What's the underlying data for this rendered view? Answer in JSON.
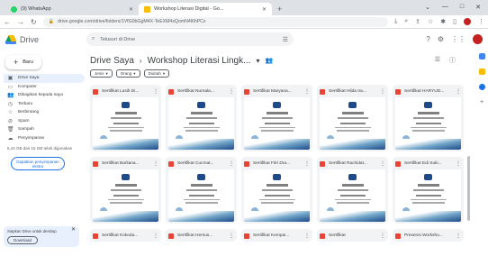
{
  "browser": {
    "tabs": [
      {
        "title": "(9) WhatsApp",
        "favicon_color": "#25d366"
      },
      {
        "title": "Workshop Literasi Digital - Go...",
        "favicon_color": "#fbbc04"
      }
    ],
    "url": "drive.google.com/drive/folders/1VfG0bGgM4X-TeEXM4xQomN4l6hPCx",
    "window_controls": [
      "⌄",
      "—",
      "□",
      "✕"
    ]
  },
  "drive": {
    "app_name": "Drive",
    "search_placeholder": "Telusuri di Drive",
    "new_button": "Baru",
    "sidebar": [
      {
        "icon": "drive-icon",
        "glyph": "▣",
        "label": "Drive Saya"
      },
      {
        "icon": "computer-icon",
        "glyph": "▭",
        "label": "Komputer"
      },
      {
        "icon": "shared-icon",
        "glyph": "👥",
        "label": "Dibagikan kepada saya"
      },
      {
        "icon": "clock-icon",
        "glyph": "◷",
        "label": "Terbaru"
      },
      {
        "icon": "star-icon",
        "glyph": "☆",
        "label": "Berbintang"
      },
      {
        "icon": "spam-icon",
        "glyph": "⊘",
        "label": "Spam"
      },
      {
        "icon": "trash-icon",
        "glyph": "🗑",
        "label": "Sampah"
      },
      {
        "icon": "cloud-icon",
        "glyph": "☁",
        "label": "Penyimpanan"
      }
    ],
    "storage_text": "5,44 GB dari 15 GB telah digunakan",
    "get_storage_button": "Dapatkan penyimpanan ekstra",
    "toast": {
      "text": "Siapkan Drive untuk desktop",
      "button": "Download"
    },
    "breadcrumb": {
      "root": "Drive Saya",
      "separator": "›",
      "folder": "Workshop Literasi Lingk...",
      "dropdown": "▾"
    },
    "filters": [
      {
        "label": "Jenis"
      },
      {
        "label": "Orang"
      },
      {
        "label": "Diubah"
      }
    ],
    "files": [
      {
        "name": "Sertifikat Lusih Di..."
      },
      {
        "name": "Sertifikat Nurnala..."
      },
      {
        "name": "Sertifikat Maryana..."
      },
      {
        "name": "Sertifikat Hilda Ira..."
      },
      {
        "name": "Sertifikat HARYUD..."
      },
      {
        "name": "Sertifikat Barliana..."
      },
      {
        "name": "Sertifikat Cucmat..."
      },
      {
        "name": "Sertifikat Fitri Dra..."
      },
      {
        "name": "Sertifikat Rachidat..."
      },
      {
        "name": "Sertifikat Edi Suki..."
      },
      {
        "name": "Sertifikat Kokoda..."
      },
      {
        "name": "Sertifikat Hersus..."
      },
      {
        "name": "Sertifikat Kempai..."
      },
      {
        "name": "Sertifikat"
      },
      {
        "name": "Presensi Worksho..."
      }
    ],
    "colors": {
      "accent": "#1a73e8",
      "pdf": "#ea4335"
    }
  }
}
